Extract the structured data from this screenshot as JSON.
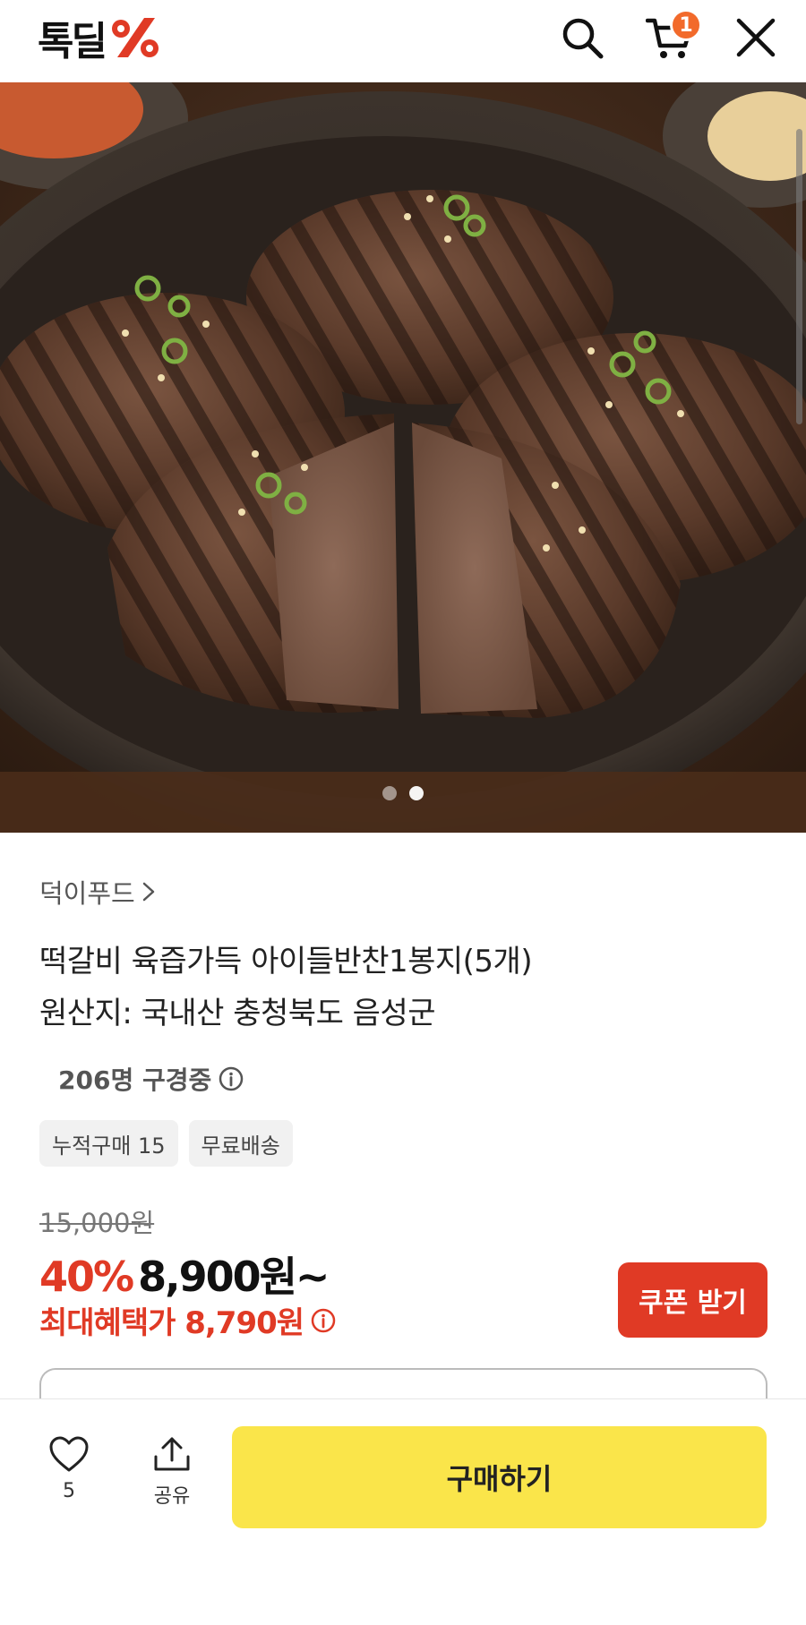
{
  "header": {
    "logo_text": "톡딜",
    "logo_mark": "%",
    "cart_count": "1",
    "icons": [
      "search-icon",
      "cart-icon",
      "close-icon"
    ]
  },
  "carousel": {
    "total_slides": 2,
    "active_slide": 2,
    "image_subject": "grilled tteokgalbi patties on a dark plate"
  },
  "product": {
    "seller": "덕이푸드",
    "title_line1": "떡갈비 육즙가득 아이들반찬1봉지(5개)",
    "title_line2": "원산지: 국내산 충청북도 음성군",
    "viewers": "206명 구경중",
    "chips": [
      "누적구매 15",
      "무료배송"
    ],
    "original_price": "15,000원",
    "discount": "40%",
    "price": "8,900원~",
    "benefit_price": "최대혜택가 8,790원",
    "coupon_label": "쿠폰 받기"
  },
  "bottom": {
    "like_count": "5",
    "share_label": "공유",
    "buy_label": "구매하기"
  },
  "colors": {
    "accent_red": "#e03a25",
    "badge_orange": "#f26a2b",
    "buy_yellow": "#fae54a"
  }
}
